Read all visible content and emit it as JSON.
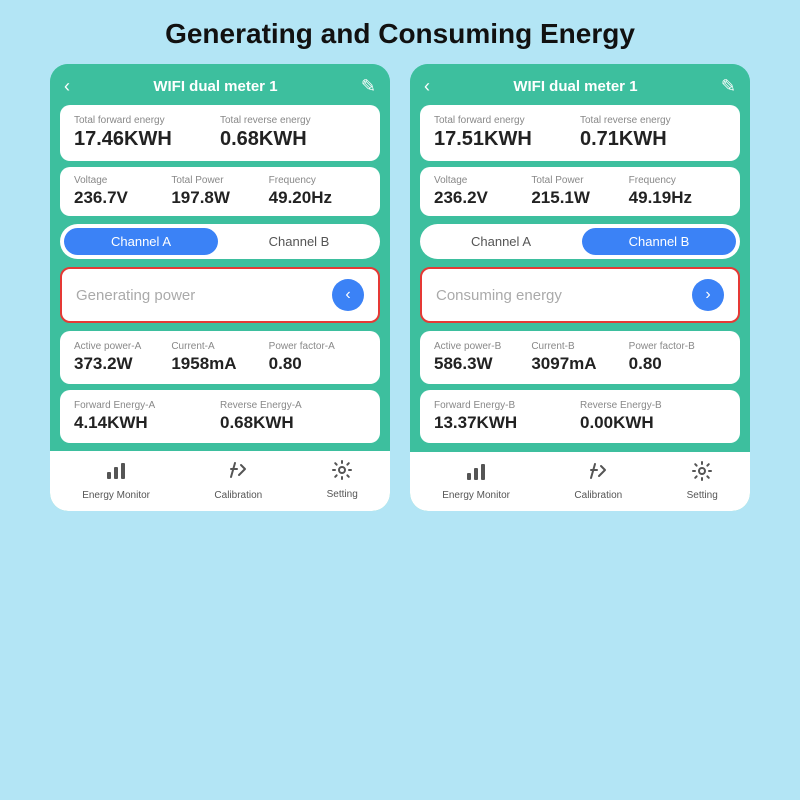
{
  "page": {
    "title": "Generating and Consuming Energy",
    "background": "#b3e5f5"
  },
  "phone_left": {
    "header": {
      "back": "‹",
      "title": "WIFI dual meter 1",
      "edit": "✎"
    },
    "energy": {
      "forward_label": "Total  forward energy",
      "forward_value": "17.46KWH",
      "reverse_label": "Total reverse energy",
      "reverse_value": "0.68KWH"
    },
    "stats": {
      "voltage_label": "Voltage",
      "voltage_value": "236.7V",
      "power_label": "Total Power",
      "power_value": "197.8W",
      "freq_label": "Frequency",
      "freq_value": "49.20Hz"
    },
    "tabs": {
      "a_label": "Channel A",
      "b_label": "Channel B",
      "active": "A"
    },
    "mode": {
      "text": "Generating power",
      "button": "‹"
    },
    "power_metrics": {
      "active_label": "Active power-A",
      "active_value": "373.2W",
      "current_label": "Current-A",
      "current_value": "1958mA",
      "pf_label": "Power factor-A",
      "pf_value": "0.80"
    },
    "energy_metrics": {
      "forward_label": "Forward Energy-A",
      "forward_value": "4.14KWH",
      "reverse_label": "Reverse Energy-A",
      "reverse_value": "0.68KWH"
    },
    "nav": {
      "item1_icon": "📊",
      "item1_label": "Energy Monitor",
      "item2_icon": "🔧",
      "item2_label": "Calibration",
      "item3_icon": "⚙",
      "item3_label": "Setting"
    }
  },
  "phone_right": {
    "header": {
      "back": "‹",
      "title": "WIFI dual meter 1",
      "edit": "✎"
    },
    "energy": {
      "forward_label": "Total  forward energy",
      "forward_value": "17.51KWH",
      "reverse_label": "Total reverse energy",
      "reverse_value": "0.71KWH"
    },
    "stats": {
      "voltage_label": "Voltage",
      "voltage_value": "236.2V",
      "power_label": "Total Power",
      "power_value": "215.1W",
      "freq_label": "Frequency",
      "freq_value": "49.19Hz"
    },
    "tabs": {
      "a_label": "Channel A",
      "b_label": "Channel B",
      "active": "B"
    },
    "mode": {
      "text": "Consuming energy",
      "button": "›"
    },
    "power_metrics": {
      "active_label": "Active power-B",
      "active_value": "586.3W",
      "current_label": "Current-B",
      "current_value": "3097mA",
      "pf_label": "Power factor-B",
      "pf_value": "0.80"
    },
    "energy_metrics": {
      "forward_label": "Forward Energy-B",
      "forward_value": "13.37KWH",
      "reverse_label": "Reverse Energy-B",
      "reverse_value": "0.00KWH"
    },
    "nav": {
      "item1_icon": "📊",
      "item1_label": "Energy Monitor",
      "item2_icon": "🔧",
      "item2_label": "Calibration",
      "item3_icon": "⚙",
      "item3_label": "Setting"
    }
  }
}
